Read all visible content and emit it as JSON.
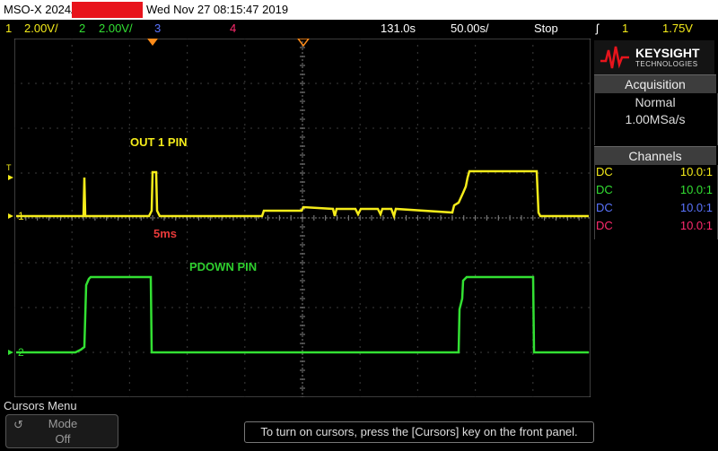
{
  "title_bar": {
    "model": "MSO-X 2024A,",
    "datetime": "Wed Nov 27 08:15:47 2019"
  },
  "status_bar": {
    "ch1_num": "1",
    "ch1_scale": "2.00V/",
    "ch2_num": "2",
    "ch2_scale": "2.00V/",
    "ch3_num": "3",
    "ch4_num": "4",
    "delay": "131.0s",
    "timebase": "50.00s/",
    "run_state": "Stop",
    "trigger_channel": "1",
    "trigger_level": "1.75V"
  },
  "screen": {
    "annotation_out1": "OUT 1 PIN",
    "annotation_5ms": "5ms",
    "annotation_pdown": "PDOWN PIN",
    "marker_trigger_level": "T",
    "marker_ch1": "1",
    "marker_ch2": "2"
  },
  "panel": {
    "logo_line1": "KEYSIGHT",
    "logo_line2": "TECHNOLOGIES",
    "acquisition_header": "Acquisition",
    "acq_mode": "Normal",
    "acq_rate": "1.00MSa/s",
    "channels_header": "Channels",
    "channels": [
      {
        "coupling": "DC",
        "probe": "10.0:1",
        "color": "#f5ec1a"
      },
      {
        "coupling": "DC",
        "probe": "10.0:1",
        "color": "#33e033"
      },
      {
        "coupling": "DC",
        "probe": "10.0:1",
        "color": "#5a74ff"
      },
      {
        "coupling": "DC",
        "probe": "10.0:1",
        "color": "#ff2a6e"
      }
    ]
  },
  "bottom": {
    "menu_label": "Cursors Menu",
    "mode_label": "Mode",
    "mode_value": "Off",
    "hint": "To turn on cursors, press the [Cursors] key on the front panel."
  },
  "colors": {
    "ch1": "#f5ec1a",
    "ch2": "#33e033",
    "ch3": "#5a74ff",
    "ch4": "#ff2a6e",
    "annotation_red": "#e83a3a",
    "annotation_green": "#2fcf2f",
    "trigger_orange": "#ff8c1a"
  },
  "chart_data": {
    "type": "line",
    "series": [
      {
        "color": "#f5ec1a",
        "description_level": "ch1 pulse then steps high"
      },
      {
        "color": "#33e033",
        "description_level": "ch2 pulses high twice"
      }
    ]
  }
}
